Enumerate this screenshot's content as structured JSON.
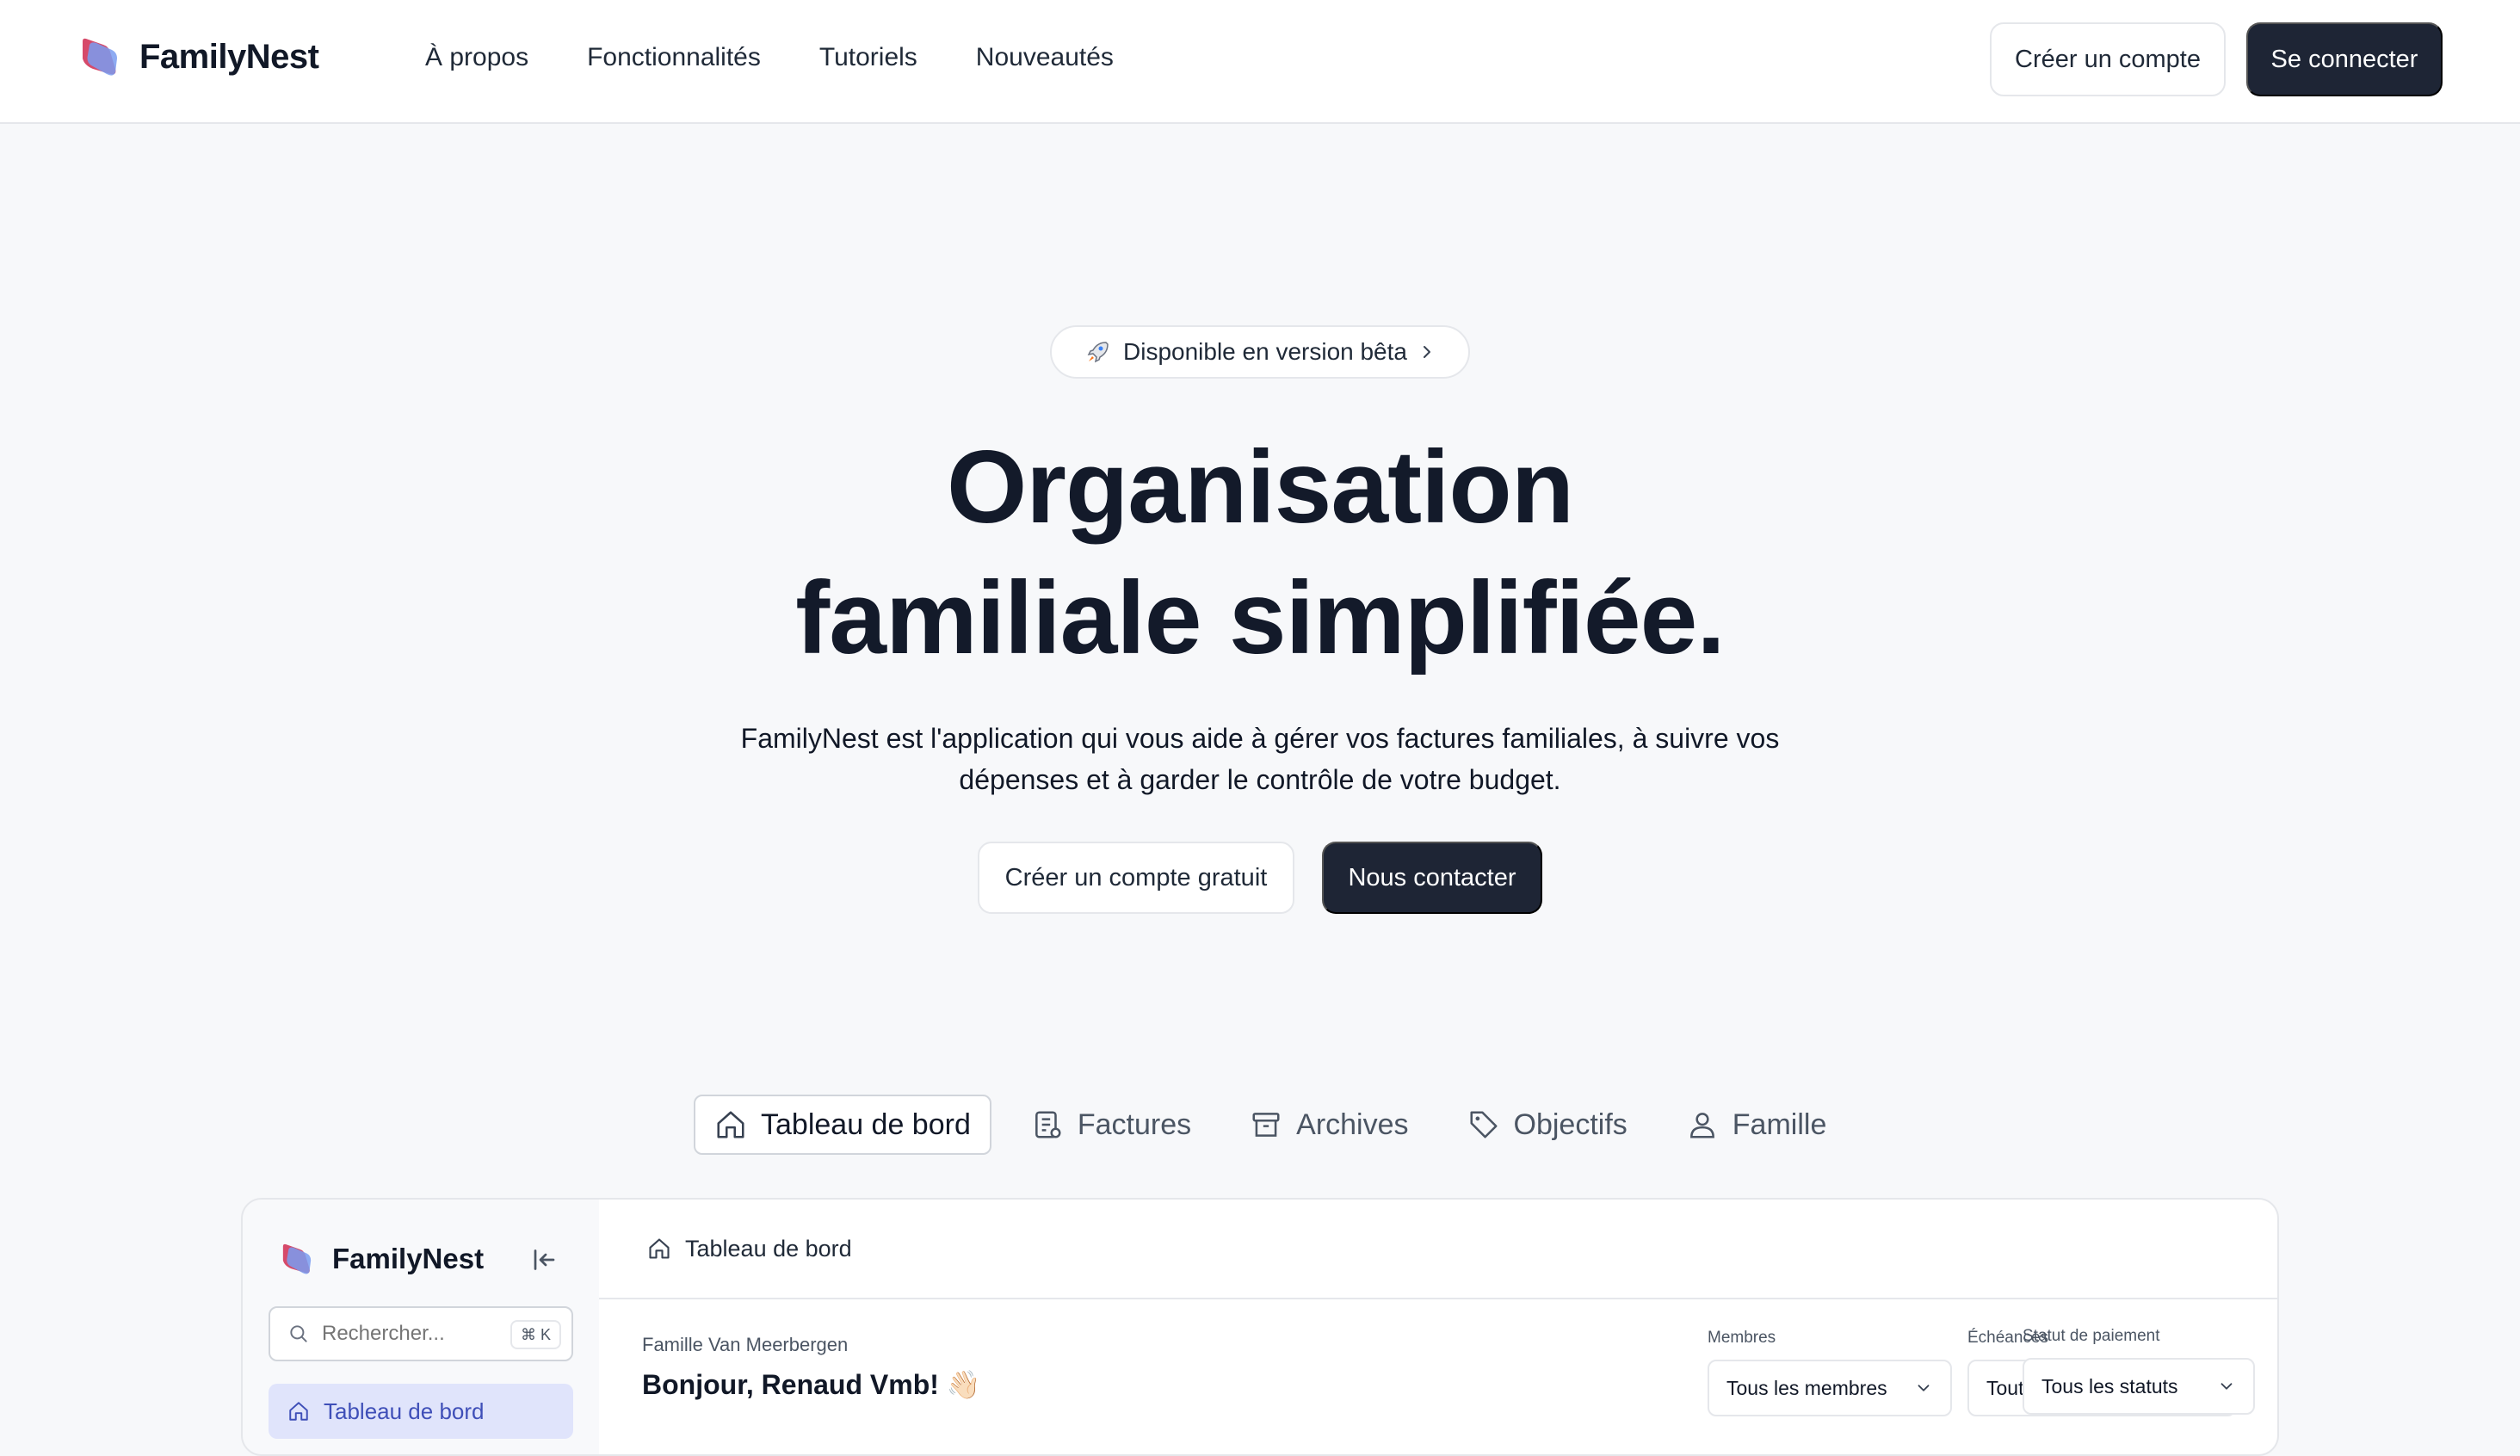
{
  "nav": {
    "brand": "FamilyNest",
    "links": [
      "À propos",
      "Fonctionnalités",
      "Tutoriels",
      "Nouveautés"
    ],
    "create_account": "Créer un compte",
    "sign_in": "Se connecter"
  },
  "hero": {
    "pill_label": "Disponible en version bêta",
    "title_line1": "Organisation",
    "title_line2": "familiale simplifiée.",
    "subtitle": "FamilyNest est l'application qui vous aide à gérer vos factures familiales, à suivre vos dépenses et à garder le contrôle de votre budget.",
    "cta_secondary": "Créer un compte gratuit",
    "cta_primary": "Nous contacter"
  },
  "tabs": [
    {
      "label": "Tableau de bord",
      "icon": "home-icon",
      "active": true
    },
    {
      "label": "Factures",
      "icon": "receipt-icon",
      "active": false
    },
    {
      "label": "Archives",
      "icon": "archive-icon",
      "active": false
    },
    {
      "label": "Objectifs",
      "icon": "tag-icon",
      "active": false
    },
    {
      "label": "Famille",
      "icon": "user-icon",
      "active": false
    }
  ],
  "preview": {
    "sidebar": {
      "brand": "FamilyNest",
      "search_placeholder": "Rechercher...",
      "shortcut": "⌘ K",
      "active_item": "Tableau de bord"
    },
    "header_title": "Tableau de bord",
    "family_name": "Famille Van Meerbergen",
    "greeting": "Bonjour, Renaud Vmb! 👋🏻",
    "filters": [
      {
        "label": "Membres",
        "value": "Tous les membres"
      },
      {
        "label": "Échéances",
        "value": "Toutes les échéances"
      },
      {
        "label": "Statut de paiement",
        "value": "Tous les statuts"
      }
    ]
  },
  "colors": {
    "dark_button": "#1e2535",
    "page_bg": "#f7f8fa",
    "active_sidebar": "#e0e4fb",
    "active_sidebar_text": "#3f4fb8"
  }
}
